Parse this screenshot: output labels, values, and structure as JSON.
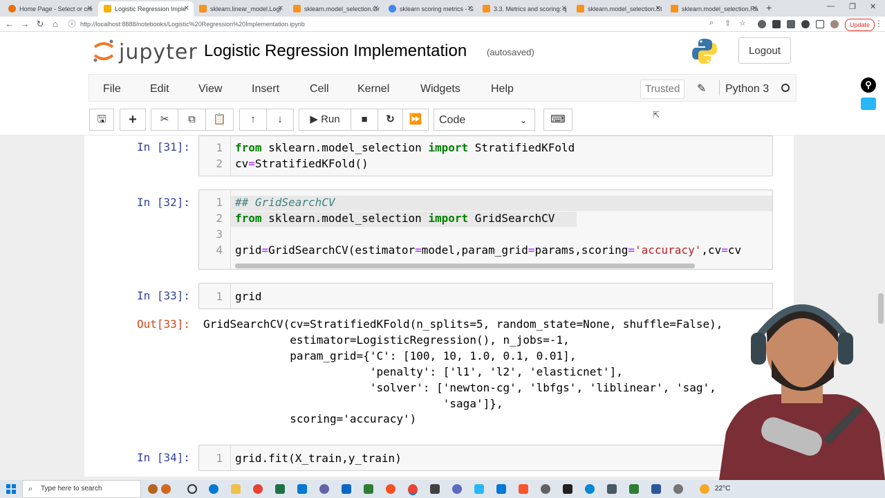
{
  "browser": {
    "tabs": [
      {
        "title": "Home Page - Select or cre",
        "active": false
      },
      {
        "title": "Logistic Regression Imple",
        "active": true
      },
      {
        "title": "sklearn.linear_model.Logi",
        "active": false
      },
      {
        "title": "sklearn.model_selection.Gr",
        "active": false
      },
      {
        "title": "sklearn scoring metrics - G",
        "active": false
      },
      {
        "title": "3.3. Metrics and scoring: q",
        "active": false
      },
      {
        "title": "sklearn.model_selection.St",
        "active": false
      },
      {
        "title": "sklearn.model_selection.Ra",
        "active": false
      }
    ],
    "url": "http://localhost:8888/notebooks/Logistic%20Regression%20Implementation.ipynb",
    "update_label": "Update"
  },
  "jupyter": {
    "logo_text": "jupyter",
    "notebook_title": "Logistic Regression Implementation",
    "autosave": "(autosaved)",
    "logout": "Logout",
    "menu": [
      "File",
      "Edit",
      "View",
      "Insert",
      "Cell",
      "Kernel",
      "Widgets",
      "Help"
    ],
    "trusted": "Trusted",
    "kernel": "Python 3",
    "run_label": "Run",
    "cell_type": "Code"
  },
  "cells": [
    {
      "prompt": "In [31]:",
      "lines": [
        "from sklearn.model_selection import StratifiedKFold",
        "cv=StratifiedKFold()"
      ]
    },
    {
      "prompt": "In [32]:",
      "lines": [
        "## GridSearchCV",
        "from sklearn.model_selection import GridSearchCV",
        "",
        "grid=GridSearchCV(estimator=model,param_grid=params,scoring='accuracy',cv=cv"
      ]
    },
    {
      "prompt": "In [33]:",
      "lines": [
        "grid"
      ],
      "out_prompt": "Out[33]:",
      "output": [
        "GridSearchCV(cv=StratifiedKFold(n_splits=5, random_state=None, shuffle=False),",
        "             estimator=LogisticRegression(), n_jobs=-1,",
        "             param_grid={'C': [100, 10, 1.0, 0.1, 0.01],",
        "                         'penalty': ['l1', 'l2', 'elasticnet'],",
        "                         'solver': ['newton-cg', 'lbfgs', 'liblinear', 'sag',",
        "                                    'saga']},",
        "             scoring='accuracy')"
      ]
    },
    {
      "prompt": "In [34]:",
      "lines": [
        "grid.fit(X_train,y_train)"
      ]
    }
  ],
  "taskbar": {
    "search_placeholder": "Type here to search",
    "weather": "22°C"
  },
  "colors": {
    "prompt_in": "#303f9f",
    "prompt_out": "#d84315",
    "keyword": "#008000",
    "string": "#ba2121",
    "comment": "#408080"
  }
}
